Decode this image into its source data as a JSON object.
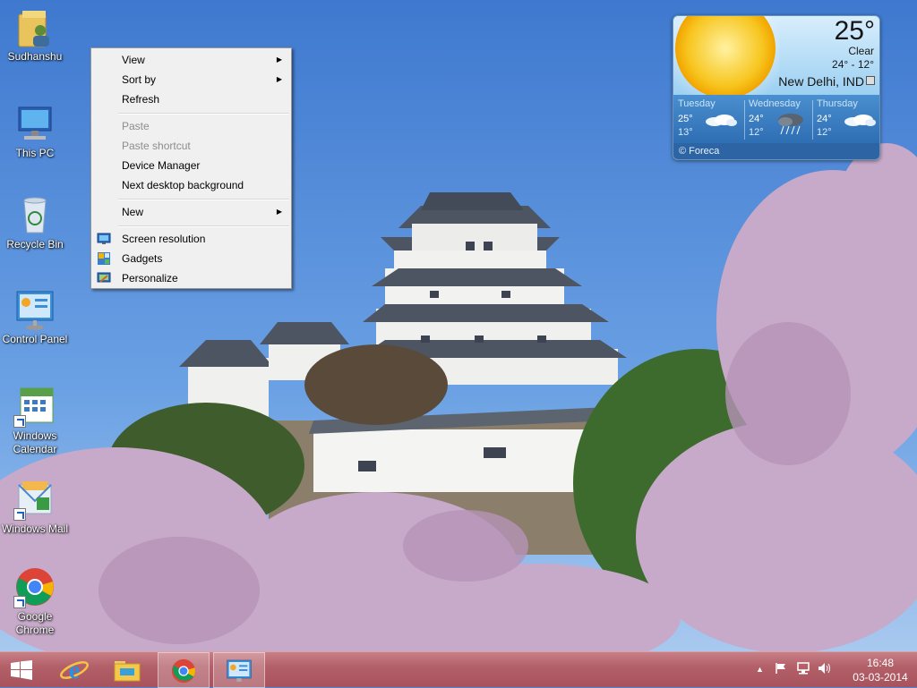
{
  "desktop": {
    "icons": [
      {
        "label": "Sudhanshu"
      },
      {
        "label": "This PC"
      },
      {
        "label": "Recycle Bin"
      },
      {
        "label": "Control Panel"
      },
      {
        "label": "Windows Calendar"
      },
      {
        "label": "Windows Mail"
      },
      {
        "label": "Google Chrome"
      }
    ]
  },
  "context_menu": {
    "items": [
      {
        "label": "View",
        "submenu": true
      },
      {
        "label": "Sort by",
        "submenu": true
      },
      {
        "label": "Refresh"
      },
      {
        "label": "Paste",
        "disabled": true
      },
      {
        "label": "Paste shortcut",
        "disabled": true
      },
      {
        "label": "Device Manager"
      },
      {
        "label": "Next desktop background"
      },
      {
        "label": "New",
        "submenu": true
      },
      {
        "label": "Screen resolution",
        "icon": "monitor-icon"
      },
      {
        "label": "Gadgets",
        "icon": "gadgets-icon"
      },
      {
        "label": "Personalize",
        "icon": "personalize-icon"
      }
    ]
  },
  "weather": {
    "temperature": "25°",
    "condition": "Clear",
    "range": "24° - 12°",
    "location": "New Delhi, IND",
    "forecast": [
      {
        "day": "Tuesday",
        "high": "25°",
        "low": "13°",
        "icon": "cloudy-icon"
      },
      {
        "day": "Wednesday",
        "high": "24°",
        "low": "12°",
        "icon": "storm-icon"
      },
      {
        "day": "Thursday",
        "high": "24°",
        "low": "12°",
        "icon": "cloudy-icon"
      }
    ],
    "provider": "© Foreca"
  },
  "taskbar": {
    "apps": [
      {
        "name": "start-button",
        "icon": "windows-logo-icon"
      },
      {
        "name": "internet-explorer",
        "icon": "ie-icon"
      },
      {
        "name": "file-explorer",
        "icon": "folder-icon"
      },
      {
        "name": "google-chrome",
        "icon": "chrome-icon"
      },
      {
        "name": "control-panel",
        "icon": "control-panel-icon"
      }
    ],
    "clock": {
      "time": "16:48",
      "date": "03-03-2014"
    }
  },
  "colors": {
    "taskbar": "#b46069",
    "sky": "#4f86d4",
    "menu_bg": "#f0f0f0"
  }
}
